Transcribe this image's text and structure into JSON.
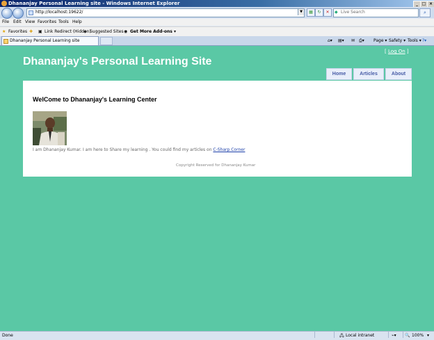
{
  "window": {
    "title": "Dhananjay Personal Learning site - Windows Internet Explorer"
  },
  "address": {
    "url": "http://localhost:19622/"
  },
  "search": {
    "placeholder": "Live Search"
  },
  "menu": {
    "items": [
      "File",
      "Edit",
      "View",
      "Favorites",
      "Tools",
      "Help"
    ]
  },
  "favorites_bar": {
    "favorites_label": "Favorites",
    "items": [
      "Link Redirect (Hidden)",
      "Suggested Sites ▾",
      "Get More Add-ons ▾"
    ]
  },
  "tab": {
    "title": "Dhananjay Personal Learning site"
  },
  "command_bar": {
    "page": "Page ▾",
    "safety": "Safety ▾",
    "tools": "Tools ▾"
  },
  "site": {
    "title": "Dhananjay's Personal Learning Site",
    "login_prefix": "[ ",
    "login_link": "Log On",
    "login_suffix": " ]",
    "nav": [
      "Home",
      "Articles",
      "About"
    ],
    "heading": "WelCome to Dhananjay's Learning Center",
    "intro_text": "I am Dhananjay Kumar. I am here to Share my learning . You could find my articles on ",
    "intro_link": "C-Sharp Corner",
    "copyright": "Copyright Reserved for Dhananjay Kumar"
  },
  "status": {
    "left": "Done",
    "zone": "Local intranet",
    "zoom": "100%"
  }
}
